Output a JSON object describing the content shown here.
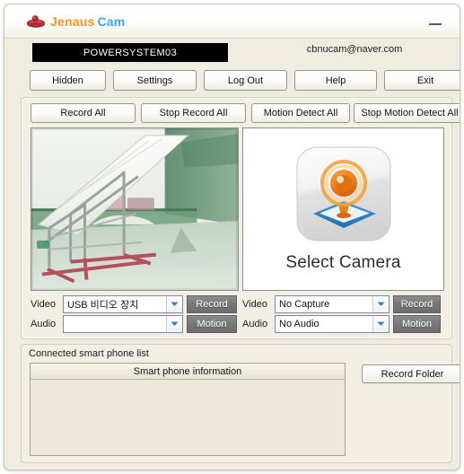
{
  "window": {
    "app_title_part1": "Jenaus",
    "app_title_part2": "Cam",
    "logo_icon": "saucer-logo-icon",
    "minimize_label": "Minimize",
    "bg_color": "#f1ece0",
    "accent_orange": "#f0952e",
    "accent_blue": "#3aa7e0"
  },
  "header": {
    "status_text": "POWERSYSTEM03",
    "account_email": "cbnucam@naver.com"
  },
  "toolbar_main": [
    {
      "label": "Hidden",
      "name": "hidden-button"
    },
    {
      "label": "Settings",
      "name": "settings-button"
    },
    {
      "label": "Log Out",
      "name": "log-out-button"
    },
    {
      "label": "Help",
      "name": "help-button"
    },
    {
      "label": "Exit",
      "name": "exit-button"
    }
  ],
  "toolbar_record": [
    {
      "label": "Record All",
      "name": "record-all-button"
    },
    {
      "label": "Stop Record All",
      "name": "stop-record-all-button"
    },
    {
      "label": "Motion Detect All",
      "name": "motion-detect-all-button"
    },
    {
      "label": "Stop Motion Detect All",
      "name": "stop-motion-detect-all-button"
    }
  ],
  "camera_left": {
    "preview_alt": "live-camera-preview",
    "video_label": "Video",
    "audio_label": "Audio",
    "video_value": "USB 비디오 장치",
    "audio_value": "",
    "record_label": "Record",
    "motion_label": "Motion"
  },
  "camera_right": {
    "placeholder_label": "Select Camera",
    "placeholder_icon": "webcam-icon",
    "video_label": "Video",
    "audio_label": "Audio",
    "video_value": "No Capture",
    "audio_value": "No Audio",
    "record_label": "Record",
    "motion_label": "Motion"
  },
  "phone_section": {
    "group_title": "Connected smart phone list",
    "column_header": "Smart phone information",
    "rows": [],
    "record_folder_label": "Record Folder"
  }
}
